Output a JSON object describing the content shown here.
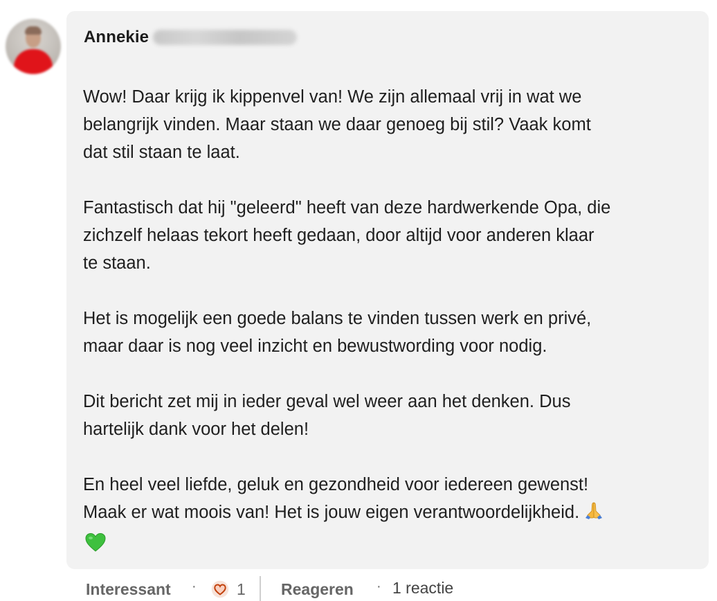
{
  "comment": {
    "author_name": "Annekie",
    "paragraphs": [
      [
        "Wow! Daar krijg ik kippenvel van! We zijn allemaal vrij in wat we",
        "belangrijk vinden. Maar staan we daar genoeg bij stil? Vaak komt",
        "dat stil staan te laat."
      ],
      [
        "Fantastisch dat hij \"geleerd\" heeft van deze hardwerkende Opa, die",
        "zichzelf helaas tekort heeft gedaan, door altijd voor anderen klaar",
        "te staan."
      ],
      [
        "Het is mogelijk een goede balans te vinden tussen werk en privé,",
        "maar daar is nog veel inzicht en bewustwording voor nodig."
      ],
      [
        "Dit bericht zet mij in ieder geval wel weer aan het denken. Dus",
        "hartelijk dank voor het delen!"
      ],
      [
        "En heel veel liefde, geluk en gezondheid voor iedereen gewenst!",
        "Maak er wat moois van! Het is jouw eigen verantwoordelijkheid."
      ]
    ],
    "emoji": {
      "pray": "🙏",
      "green_heart": "💚"
    }
  },
  "actions": {
    "reaction_label": "Interessant",
    "separator": "·",
    "reaction_icon": "heart-reaction-icon",
    "reaction_count": "1",
    "reply_label": "Reageren",
    "reply_count_text": "1 reactie"
  },
  "colors": {
    "bubble_bg": "#f2f2f2",
    "text": "#1f1f1f",
    "muted": "#666666",
    "heart_fill": "#f4d3c7",
    "heart_stroke": "#c2410c"
  }
}
